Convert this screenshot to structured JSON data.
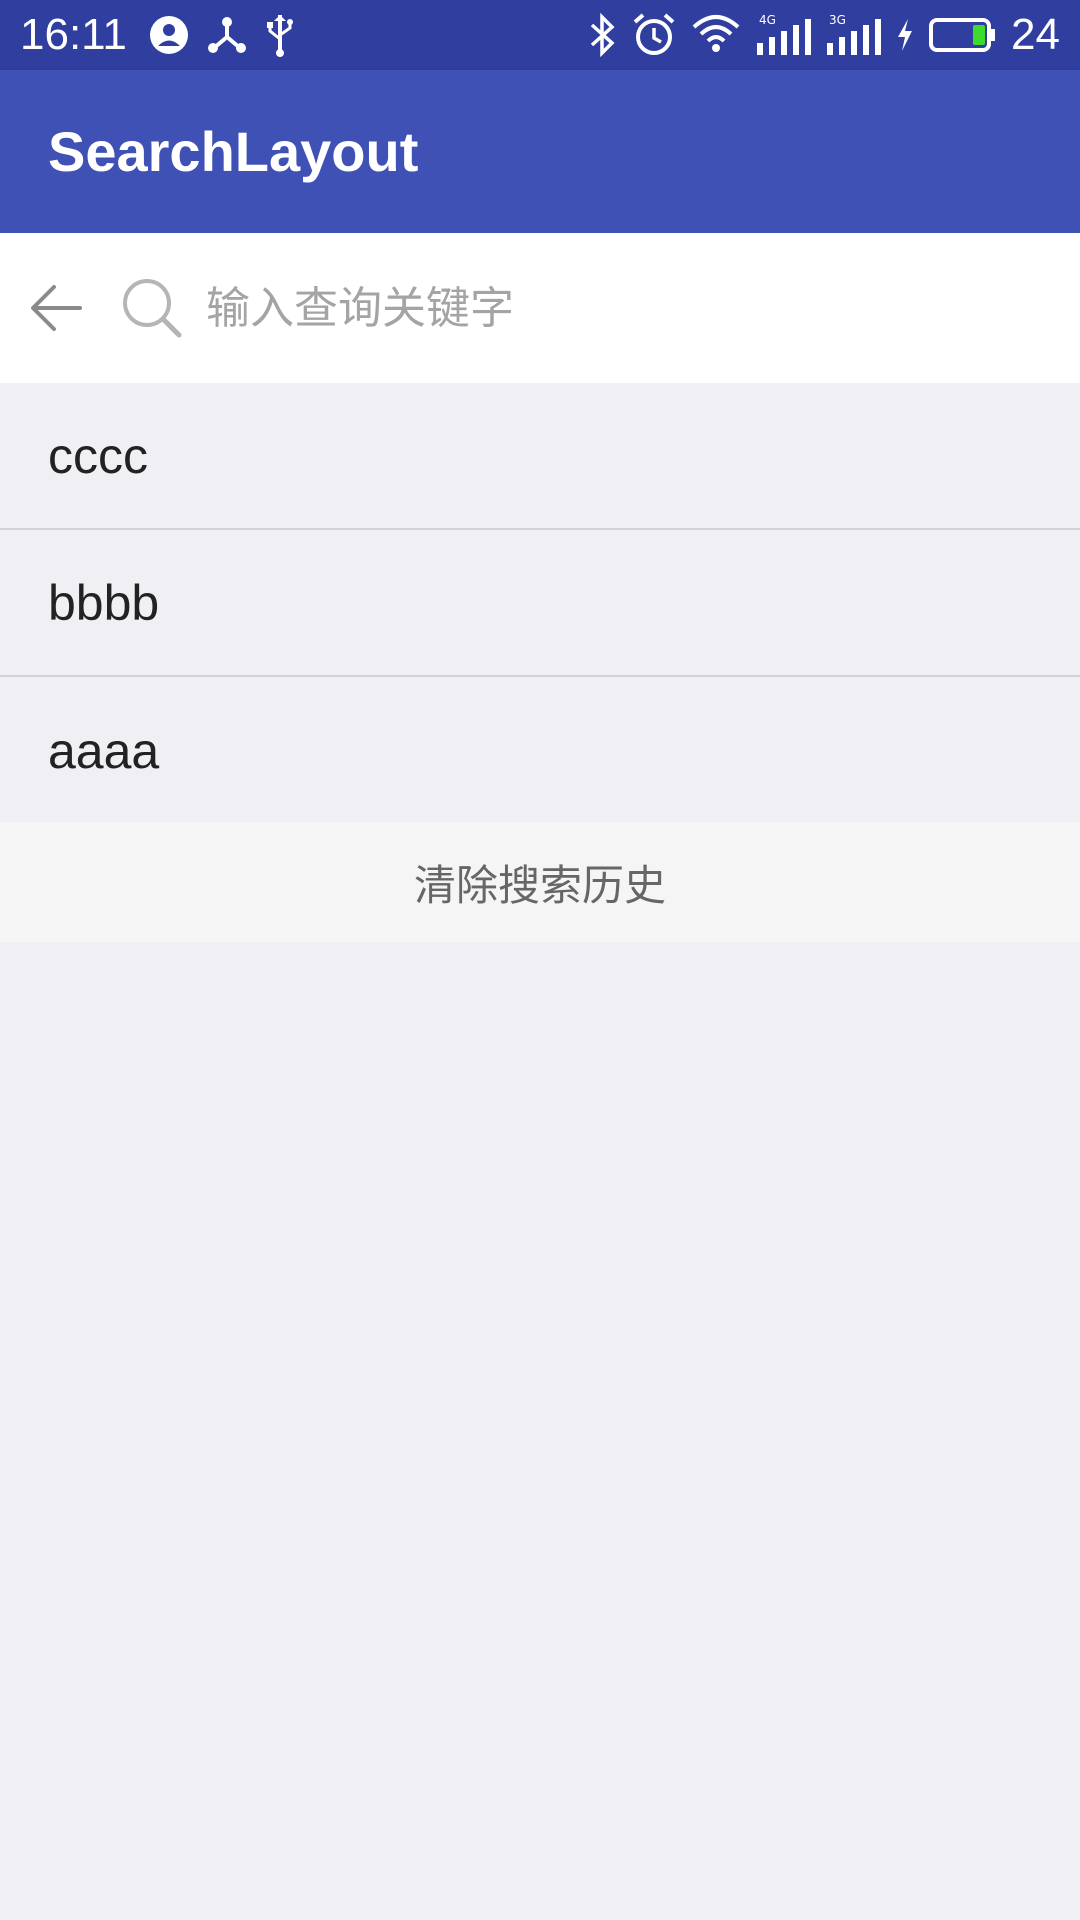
{
  "status_bar": {
    "time": "16:11",
    "battery_level": "24",
    "icons": [
      "account-circle-icon",
      "share-hub-icon",
      "usb-icon",
      "bluetooth-icon",
      "alarm-icon",
      "wifi-icon",
      "signal-4g-icon",
      "signal-3g-icon",
      "charging-icon",
      "battery-icon"
    ]
  },
  "app_bar": {
    "title": "SearchLayout",
    "color": "#3f51b5",
    "status_color": "#303f9f"
  },
  "search": {
    "placeholder": "输入查询关键字",
    "value": ""
  },
  "history": {
    "items": [
      {
        "label": "cccc"
      },
      {
        "label": "bbbb"
      },
      {
        "label": "aaaa"
      }
    ],
    "clear_label": "清除搜索历史"
  }
}
